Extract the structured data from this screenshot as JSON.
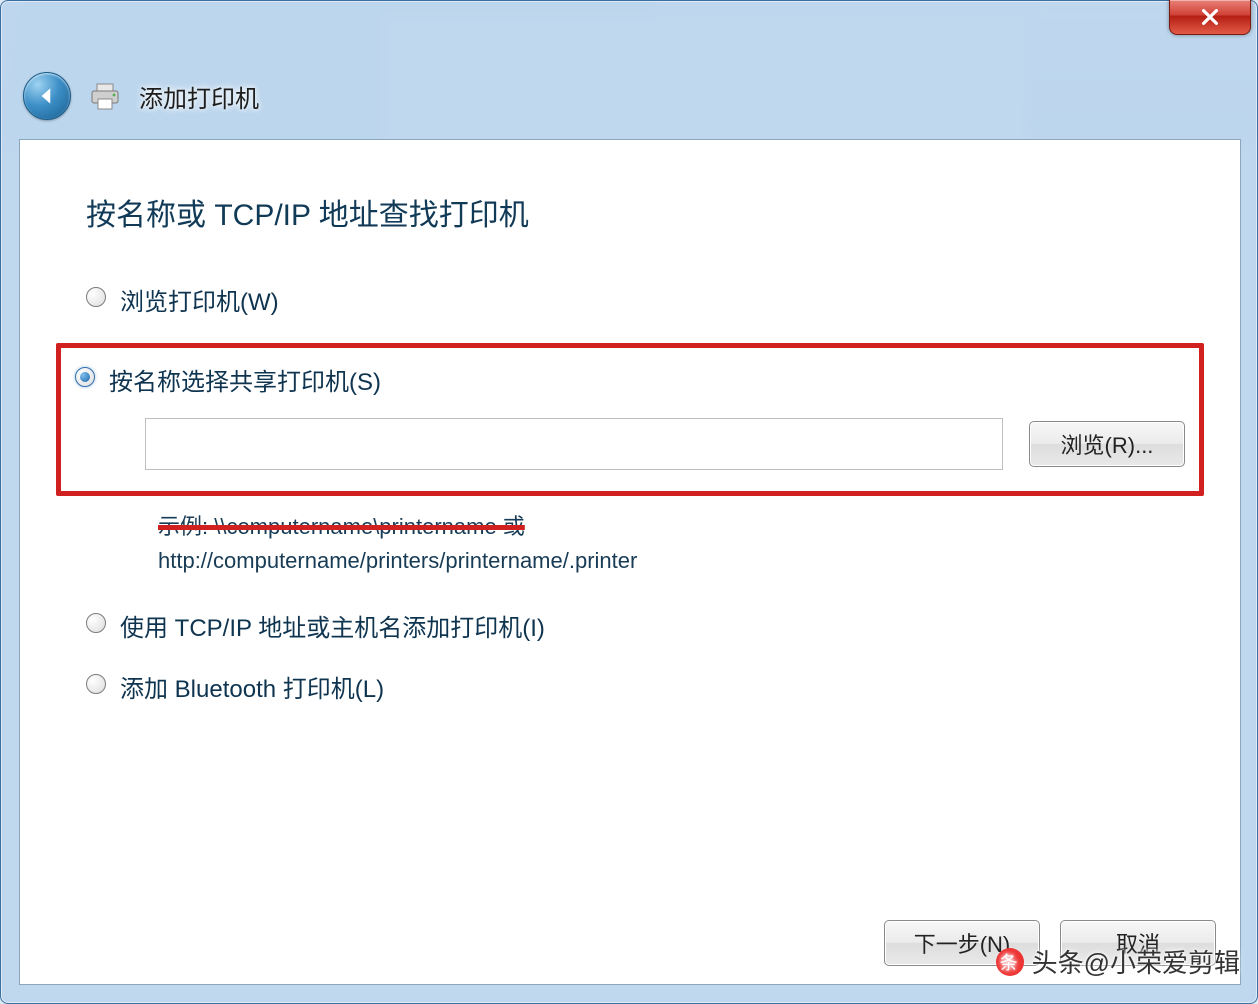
{
  "window": {
    "close_label": "X"
  },
  "header": {
    "title": "添加打印机"
  },
  "page": {
    "heading": "按名称或 TCP/IP 地址查找打印机",
    "options": {
      "browse": "浏览打印机(W)",
      "by_name": "按名称选择共享打印机(S)",
      "tcpip": "使用 TCP/IP 地址或主机名添加打印机(I)",
      "bluetooth": "添加 Bluetooth 打印机(L)"
    },
    "name_input_value": "",
    "browse_button": "浏览(R)...",
    "example_line1": "示例: \\\\computername\\printername 或",
    "example_line2": "http://computername/printers/printername/.printer"
  },
  "footer": {
    "next": "下一步(N)",
    "cancel": "取消"
  },
  "watermark": "头条@小荣爱剪辑"
}
